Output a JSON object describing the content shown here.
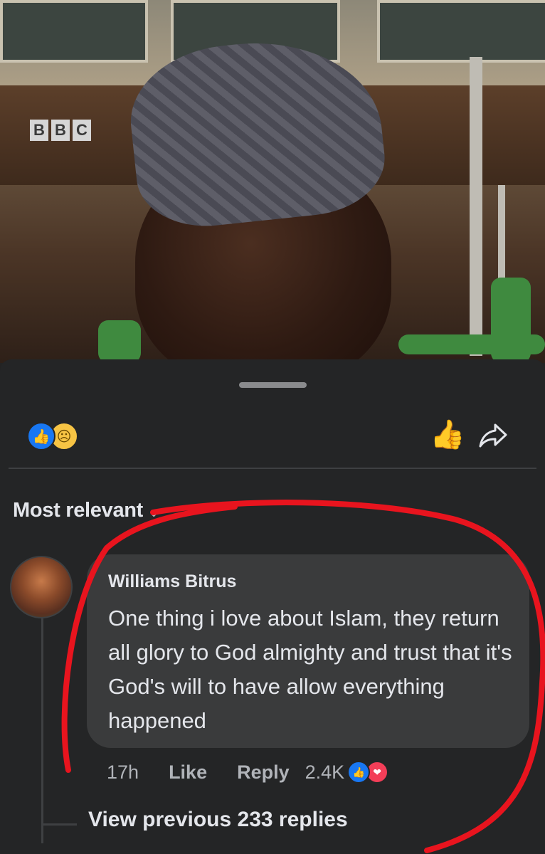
{
  "video": {
    "watermark": [
      "B",
      "B",
      "C"
    ]
  },
  "comments_sheet": {
    "sort_label": "Most relevant",
    "comment": {
      "author": "Williams Bitrus",
      "text": "One thing i love about Islam, they return all glory to God almighty and trust that it's God's will to have allow everything happened",
      "time": "17h",
      "like_label": "Like",
      "reply_label": "Reply",
      "reaction_count": "2.4K"
    },
    "view_replies_label": "View previous 233 replies"
  },
  "colors": {
    "panel": "#242526",
    "bubble": "#3a3b3c",
    "accent": "#1877f2",
    "highlight": "#e8141e"
  },
  "icons": [
    "like-reaction-icon",
    "sad-reaction-icon",
    "like-icon",
    "share-icon",
    "love-reaction-icon",
    "chevron-down-icon"
  ]
}
